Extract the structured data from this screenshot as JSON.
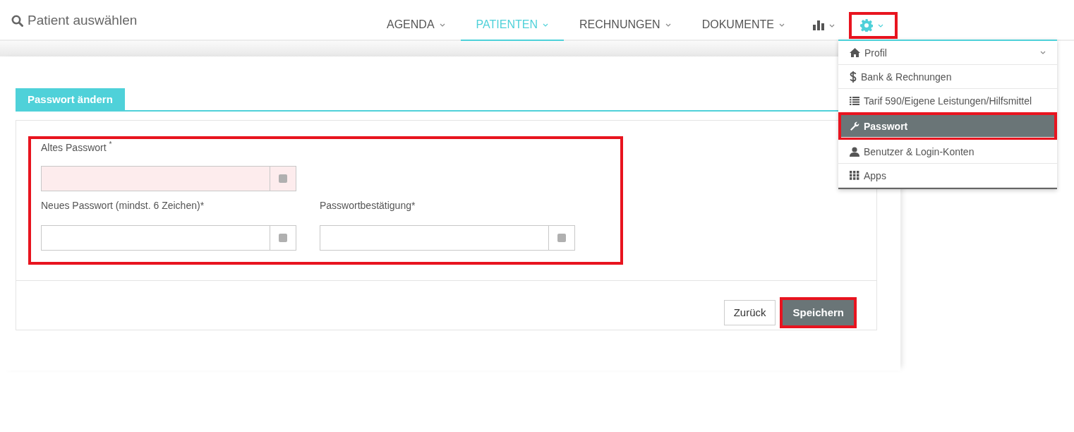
{
  "search": {
    "label": "Patient auswählen"
  },
  "nav": [
    {
      "kind": "text",
      "label": "AGENDA",
      "selected": false,
      "highlighted": false
    },
    {
      "kind": "text",
      "label": "PATIENTEN",
      "selected": true,
      "highlighted": false
    },
    {
      "kind": "text",
      "label": "RECHNUNGEN",
      "selected": false,
      "highlighted": false
    },
    {
      "kind": "text",
      "label": "DOKUMENTE",
      "selected": false,
      "highlighted": false
    },
    {
      "kind": "chart",
      "selected": false,
      "highlighted": false
    },
    {
      "kind": "gear",
      "selected": false,
      "highlighted": true
    }
  ],
  "menu": {
    "items": [
      {
        "kind": "home",
        "label": "Profil",
        "expandable": true,
        "selected": false,
        "highlighted": false
      },
      {
        "kind": "dollar",
        "label": "Bank & Rechnungen",
        "expandable": false,
        "selected": false,
        "highlighted": false
      },
      {
        "kind": "list",
        "label": "Tarif 590/Eigene Leistungen/Hilfsmittel",
        "expandable": false,
        "selected": false,
        "highlighted": false
      },
      {
        "kind": "wrench",
        "label": "Passwort",
        "expandable": false,
        "selected": true,
        "highlighted": true
      },
      {
        "kind": "user",
        "label": "Benutzer & Login-Konten",
        "expandable": false,
        "selected": false,
        "highlighted": false
      },
      {
        "kind": "grid",
        "label": "Apps",
        "expandable": false,
        "selected": false,
        "highlighted": false
      }
    ]
  },
  "tabs": [
    {
      "label": "Passwort ändern",
      "selected": true
    }
  ],
  "form": {
    "highlighted": true,
    "rows": [
      [
        {
          "label": "Altes Passwort $^{*}$",
          "invalid": true
        }
      ],
      [
        {
          "label": "Neues Passwort (mindst. 6 Zeichen)*",
          "invalid": false
        },
        {
          "label": "Passwortbestätigung*",
          "invalid": false
        }
      ]
    ]
  },
  "buttons": [
    {
      "kind": "secondary",
      "label": "Zurück",
      "highlighted": false
    },
    {
      "kind": "primary",
      "label": "Speichern",
      "highlighted": true
    }
  ]
}
